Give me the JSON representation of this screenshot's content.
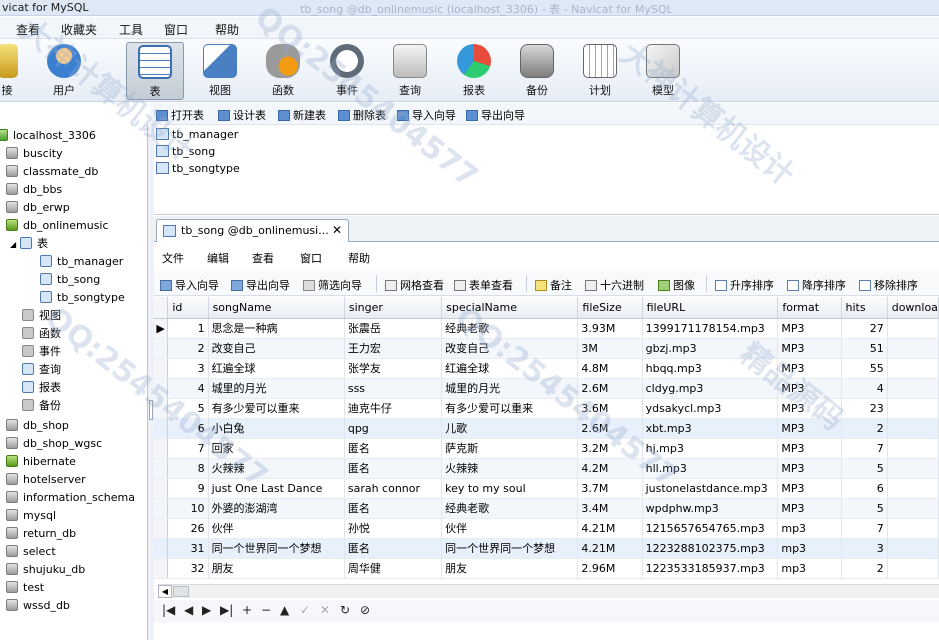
{
  "window": {
    "title": "vicat for MySQL",
    "subtitle_ghost": "tb_song @db_onlinemusic (localhost_3306) - 表 - Navicat for MySQL"
  },
  "menubar": [
    "查看",
    "收藏夹",
    "工具",
    "窗口",
    "帮助"
  ],
  "ribbon": [
    {
      "label": "接",
      "icon": "connection-icon"
    },
    {
      "label": "用户",
      "icon": "user-icon"
    },
    {
      "label": "表",
      "icon": "table-icon",
      "active": true
    },
    {
      "label": "视图",
      "icon": "view-icon"
    },
    {
      "label": "函数",
      "icon": "function-icon"
    },
    {
      "label": "事件",
      "icon": "event-icon"
    },
    {
      "label": "查询",
      "icon": "query-icon"
    },
    {
      "label": "报表",
      "icon": "report-icon"
    },
    {
      "label": "备份",
      "icon": "backup-icon"
    },
    {
      "label": "计划",
      "icon": "schedule-icon"
    },
    {
      "label": "模型",
      "icon": "model-icon"
    }
  ],
  "object_toolbar": [
    "打开表",
    "设计表",
    "新建表",
    "删除表",
    "导入向导",
    "导出向导"
  ],
  "tree": {
    "connection": "localhost_3306",
    "databases_top": [
      "buscity",
      "classmate_db",
      "db_bbs",
      "db_erwp",
      "db_onlinemusic"
    ],
    "open_db_child": "表",
    "tables": [
      "tb_manager",
      "tb_song",
      "tb_songtype"
    ],
    "db_children": [
      "视图",
      "函数",
      "事件",
      "查询",
      "报表",
      "备份"
    ],
    "databases_bottom": [
      "db_shop",
      "db_shop_wgsc",
      "hibernate",
      "hotelserver",
      "information_schema",
      "mysql",
      "return_db",
      "select",
      "shujuku_db",
      "test",
      "wssd_db"
    ]
  },
  "object_list": [
    "tb_manager",
    "tb_song",
    "tb_songtype"
  ],
  "tab": {
    "label": "tb_song @db_onlinemusi...",
    "close": "✕"
  },
  "window_menu": [
    "文件",
    "编辑",
    "查看",
    "窗口",
    "帮助"
  ],
  "grid_toolbar": [
    "导入向导",
    "导出向导",
    "筛选向导",
    "网格查看",
    "表单查看",
    "备注",
    "十六进制",
    "图像",
    "升序排序",
    "降序排序",
    "移除排序"
  ],
  "columns": [
    "id",
    "songName",
    "singer",
    "specialName",
    "fileSize",
    "fileURL",
    "format",
    "hits",
    "downloa"
  ],
  "rows": [
    [
      "1",
      "思念是一种病",
      "张震岳",
      "经典老歌",
      "3.93M",
      "1399171178154.mp3",
      "MP3",
      "27"
    ],
    [
      "2",
      "改变自己",
      "王力宏",
      "改变自己",
      "3M",
      "gbzj.mp3",
      "MP3",
      "51"
    ],
    [
      "3",
      "红遍全球",
      "张学友",
      "红遍全球",
      "4.8M",
      "hbqq.mp3",
      "MP3",
      "55"
    ],
    [
      "4",
      "城里的月光",
      "sss",
      "城里的月光",
      "2.6M",
      "cldyg.mp3",
      "MP3",
      "4"
    ],
    [
      "5",
      "有多少爱可以重来",
      "迪克牛仔",
      "有多少爱可以重来",
      "3.6M",
      "ydsakycl.mp3",
      "MP3",
      "23"
    ],
    [
      "6",
      "小白兔",
      "qpg",
      "儿歌",
      "2.6M",
      "xbt.mp3",
      "MP3",
      "2"
    ],
    [
      "7",
      "回家",
      "匿名",
      "萨克斯",
      "3.2M",
      "hj.mp3",
      "MP3",
      "7"
    ],
    [
      "8",
      "火辣辣",
      "匿名",
      "火辣辣",
      "4.2M",
      "hll.mp3",
      "MP3",
      "5"
    ],
    [
      "9",
      "just One Last Dance",
      "sarah connor",
      "key to my soul",
      "3.7M",
      "justonelastdance.mp3",
      "MP3",
      "6"
    ],
    [
      "10",
      "外婆的澎湖湾",
      "匿名",
      "经典老歌",
      "3.4M",
      "wpdphw.mp3",
      "MP3",
      "5"
    ],
    [
      "26",
      "伙伴",
      "孙悦",
      "伙伴",
      "4.21M",
      "1215657654765.mp3",
      "mp3",
      "7"
    ],
    [
      "31",
      "同一个世界同一个梦想",
      "匿名",
      "同一个世界同一个梦想",
      "4.21M",
      "1223288102375.mp3",
      "mp3",
      "3"
    ],
    [
      "32",
      "朋友",
      "周华健",
      "朋友",
      "2.96M",
      "1223533185937.mp3",
      "mp3",
      "2"
    ]
  ],
  "navigator": [
    "|◀",
    "◀",
    "▶",
    "▶|",
    "+",
    "−",
    "▲",
    "✓",
    "✕",
    "↻",
    "⊘"
  ],
  "watermarks": [
    "大神计算机设计",
    "QQ:2545404577",
    "精品源码"
  ]
}
